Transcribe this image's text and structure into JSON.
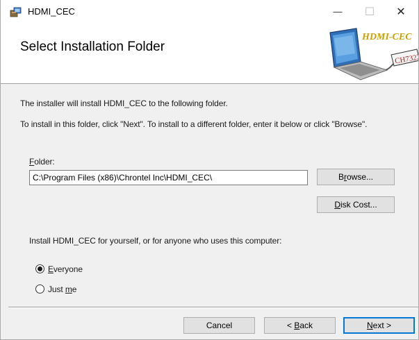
{
  "window": {
    "title": "HDMI_CEC",
    "minimize_glyph": "—",
    "maximize_glyph": "☐",
    "close_glyph": "✕"
  },
  "banner": {
    "title": "Select Installation Folder",
    "logo_text": "HDMI-CEC",
    "chip_text": "CH7322"
  },
  "body": {
    "intro": "The installer will install HDMI_CEC to the following folder.",
    "instructions": "To install in this folder, click \"Next\". To install to a different folder, enter it below or click \"Browse\"."
  },
  "folder": {
    "label_accel": "F",
    "label_rest": "older:",
    "value": "C:\\Program Files (x86)\\Chrontel Inc\\HDMI_CEC\\"
  },
  "buttons": {
    "browse_pre": "B",
    "browse_accel": "r",
    "browse_post": "owse...",
    "disk_cost_accel": "D",
    "disk_cost_post": "isk Cost...",
    "cancel": "Cancel",
    "back_pre": "< ",
    "back_accel": "B",
    "back_post": "ack",
    "next_accel": "N",
    "next_post": "ext >"
  },
  "install_for": {
    "prompt": "Install HDMI_CEC for yourself, or for anyone who uses this computer:",
    "options": [
      {
        "accel": "E",
        "rest": "veryone",
        "pre": "",
        "selected": true
      },
      {
        "pre": "Just ",
        "accel": "m",
        "rest": "e",
        "selected": false
      }
    ]
  },
  "colors": {
    "default_button_border": "#0078d7",
    "window_bg": "#f0f0f0",
    "logo_text": "#c8a000",
    "chip_text": "#b22222"
  },
  "icons": {
    "app": "installer-package-icon",
    "banner": "laptop-logo-graphic"
  }
}
